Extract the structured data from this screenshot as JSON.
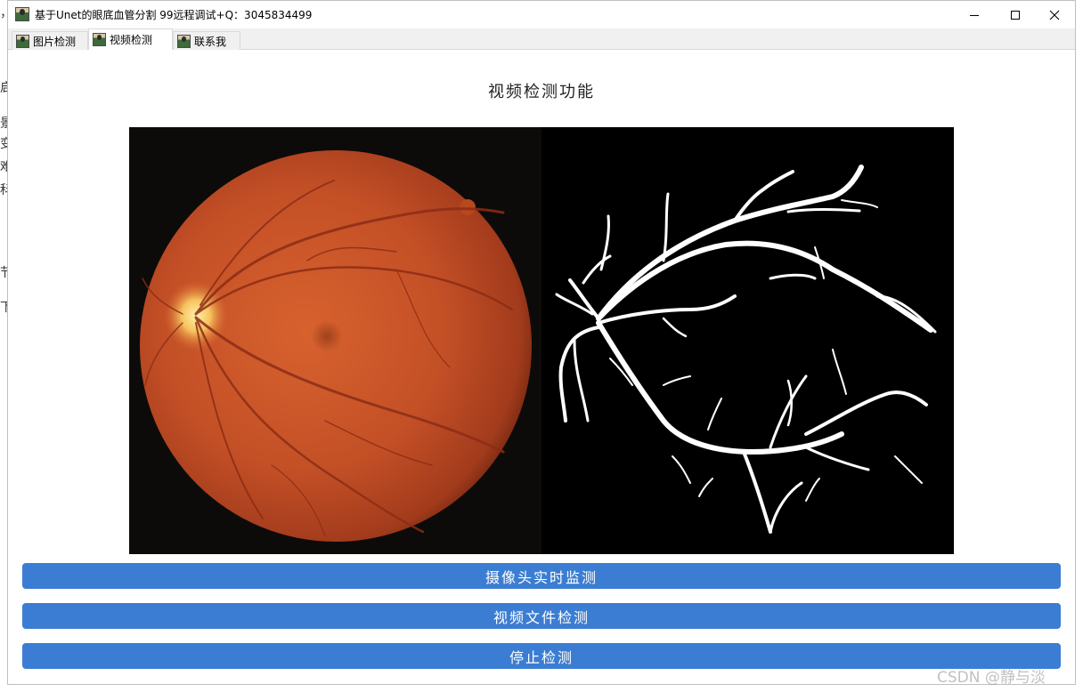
{
  "window": {
    "title": "基于Unet的眼底血管分割 99远程调试+Q：3045834499",
    "controls": {
      "minimize_icon": "minimize-icon",
      "maximize_icon": "maximize-icon",
      "close_icon": "close-icon"
    }
  },
  "tabs": [
    {
      "label": "图片检测",
      "active": false
    },
    {
      "label": "视频检测",
      "active": true
    },
    {
      "label": "联系我",
      "active": false
    }
  ],
  "main": {
    "heading": "视频检测功能",
    "image_panel": {
      "left": "fundus-photo",
      "right": "vessel-segmentation-mask"
    }
  },
  "buttons": {
    "camera": "摄像头实时监测",
    "video_file": "视频文件检测",
    "stop": "停止检测"
  },
  "background_fragments": [
    "，",
    "启",
    "景",
    "变",
    "难",
    "科",
    "节",
    "下"
  ],
  "watermark": "CSDN @静与淡",
  "colors": {
    "button_blue": "#3b7dd2",
    "panel_black": "#000000",
    "fundus_orange": "#c8502a"
  }
}
